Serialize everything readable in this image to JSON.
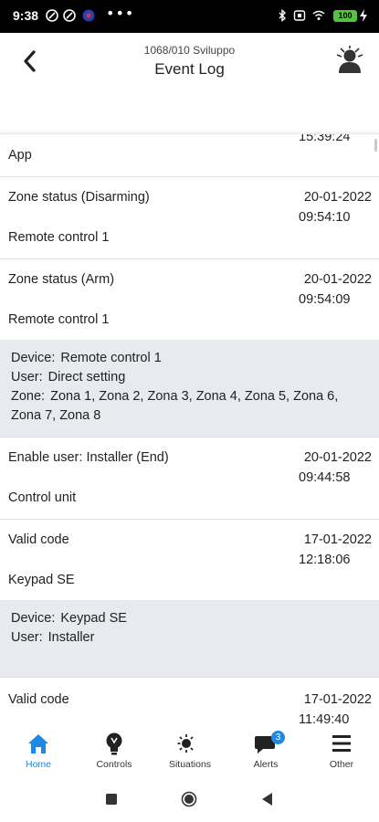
{
  "status_bar": {
    "time": "9:38",
    "battery": "100"
  },
  "header": {
    "subtitle": "1068/010 Sviluppo",
    "title": "Event Log"
  },
  "events_partial": {
    "time": "15:39:24",
    "source": "App"
  },
  "events": [
    {
      "event": "Zone status (Disarming)",
      "date": "20-01-2022",
      "time": "09:54:10",
      "source": "Remote control 1"
    },
    {
      "event": "Zone status (Arm)",
      "date": "20-01-2022",
      "time": "09:54:09",
      "source": "Remote control 1",
      "details": [
        {
          "key": "Device:",
          "value": "Remote control 1"
        },
        {
          "key": "User:",
          "value": "Direct setting"
        },
        {
          "key": "Zone:",
          "value": "Zona 1, Zona 2, Zona 3, Zona 4, Zona 5, Zona 6, Zona 7, Zona 8"
        }
      ]
    },
    {
      "event": "Enable user:  Installer (End)",
      "date": "20-01-2022",
      "time": "09:44:58",
      "source": "Control unit"
    },
    {
      "event": "Valid code",
      "date": "17-01-2022",
      "time": "12:18:06",
      "source": "Keypad SE",
      "details": [
        {
          "key": "Device:",
          "value": "Keypad SE"
        },
        {
          "key": "User:",
          "value": "Installer"
        }
      ]
    },
    {
      "event": "Valid code",
      "date": "17-01-2022",
      "time": "11:49:40"
    }
  ],
  "bottom_nav": [
    {
      "label": "Home",
      "icon": "home-icon",
      "active": true
    },
    {
      "label": "Controls",
      "icon": "bulb-icon",
      "active": false
    },
    {
      "label": "Situations",
      "icon": "sun-moon-icon",
      "active": false
    },
    {
      "label": "Alerts",
      "icon": "chat-bubble-icon",
      "active": false,
      "badge": "3"
    },
    {
      "label": "Other",
      "icon": "menu-icon",
      "active": false
    }
  ],
  "colors": {
    "accent": "#1e88e5",
    "details_bg": "#e7eaee",
    "battery": "#57c242"
  }
}
